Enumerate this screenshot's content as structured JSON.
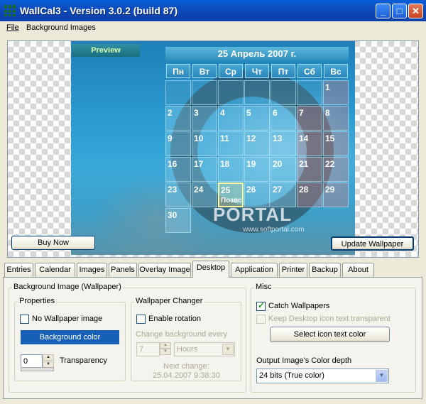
{
  "window": {
    "title": "WallCal3 - Version 3.0.2 (build 87)",
    "minimize": "_",
    "maximize": "□",
    "close": "✕"
  },
  "menu": {
    "file": "File",
    "background_images": "Background Images"
  },
  "preview": {
    "label": "Preview",
    "calendar_title": "25 Апрель 2007 г.",
    "weekdays": [
      "Пн",
      "Вт",
      "Ср",
      "Чт",
      "Пт",
      "Сб",
      "Вс"
    ],
    "today_note": "Позвс",
    "watermark": "PORTAL",
    "watermark_url": "www.softportal.com",
    "days": [
      "1",
      "2",
      "3",
      "4",
      "5",
      "6",
      "7",
      "8",
      "9",
      "10",
      "11",
      "12",
      "13",
      "14",
      "15",
      "16",
      "17",
      "18",
      "19",
      "20",
      "21",
      "22",
      "23",
      "24",
      "25",
      "26",
      "27",
      "28",
      "29",
      "30"
    ]
  },
  "buttons": {
    "buy_now": "Buy Now",
    "update_wallpaper": "Update Wallpaper"
  },
  "tabs": [
    "Entries",
    "Calendar",
    "Images",
    "Panels",
    "Overlay Image",
    "Desktop",
    "Application",
    "Printer",
    "Backup",
    "About"
  ],
  "active_tab": "Desktop",
  "desktop": {
    "background_group": "Background Image (Wallpaper)",
    "properties_group": "Properties",
    "no_wallpaper": "No Wallpaper image",
    "background_color_button": "Background color",
    "transparency_value": "0",
    "transparency_label": "Transparency",
    "changer_group": "Wallpaper Changer",
    "enable_rotation": "Enable rotation",
    "change_every_label": "Change background every",
    "interval_value": "7",
    "interval_unit": "Hours",
    "next_change_label": "Next change:",
    "next_change_value": "25.04.2007 9:38:30",
    "misc_group": "Misc",
    "catch_wallpapers": "Catch Wallpapers",
    "catch_wallpapers_checked": true,
    "keep_icon_text": "Keep Desktop icon text transparent",
    "select_icon_text_color": "Select icon text color",
    "output_depth_label": "Output Image's Color depth",
    "output_depth_value": "24 bits (True color)"
  },
  "colors": {
    "titlebar": "#0d4dbf",
    "background_color_button": "#1760b8",
    "panel": "#f4f3ee"
  }
}
